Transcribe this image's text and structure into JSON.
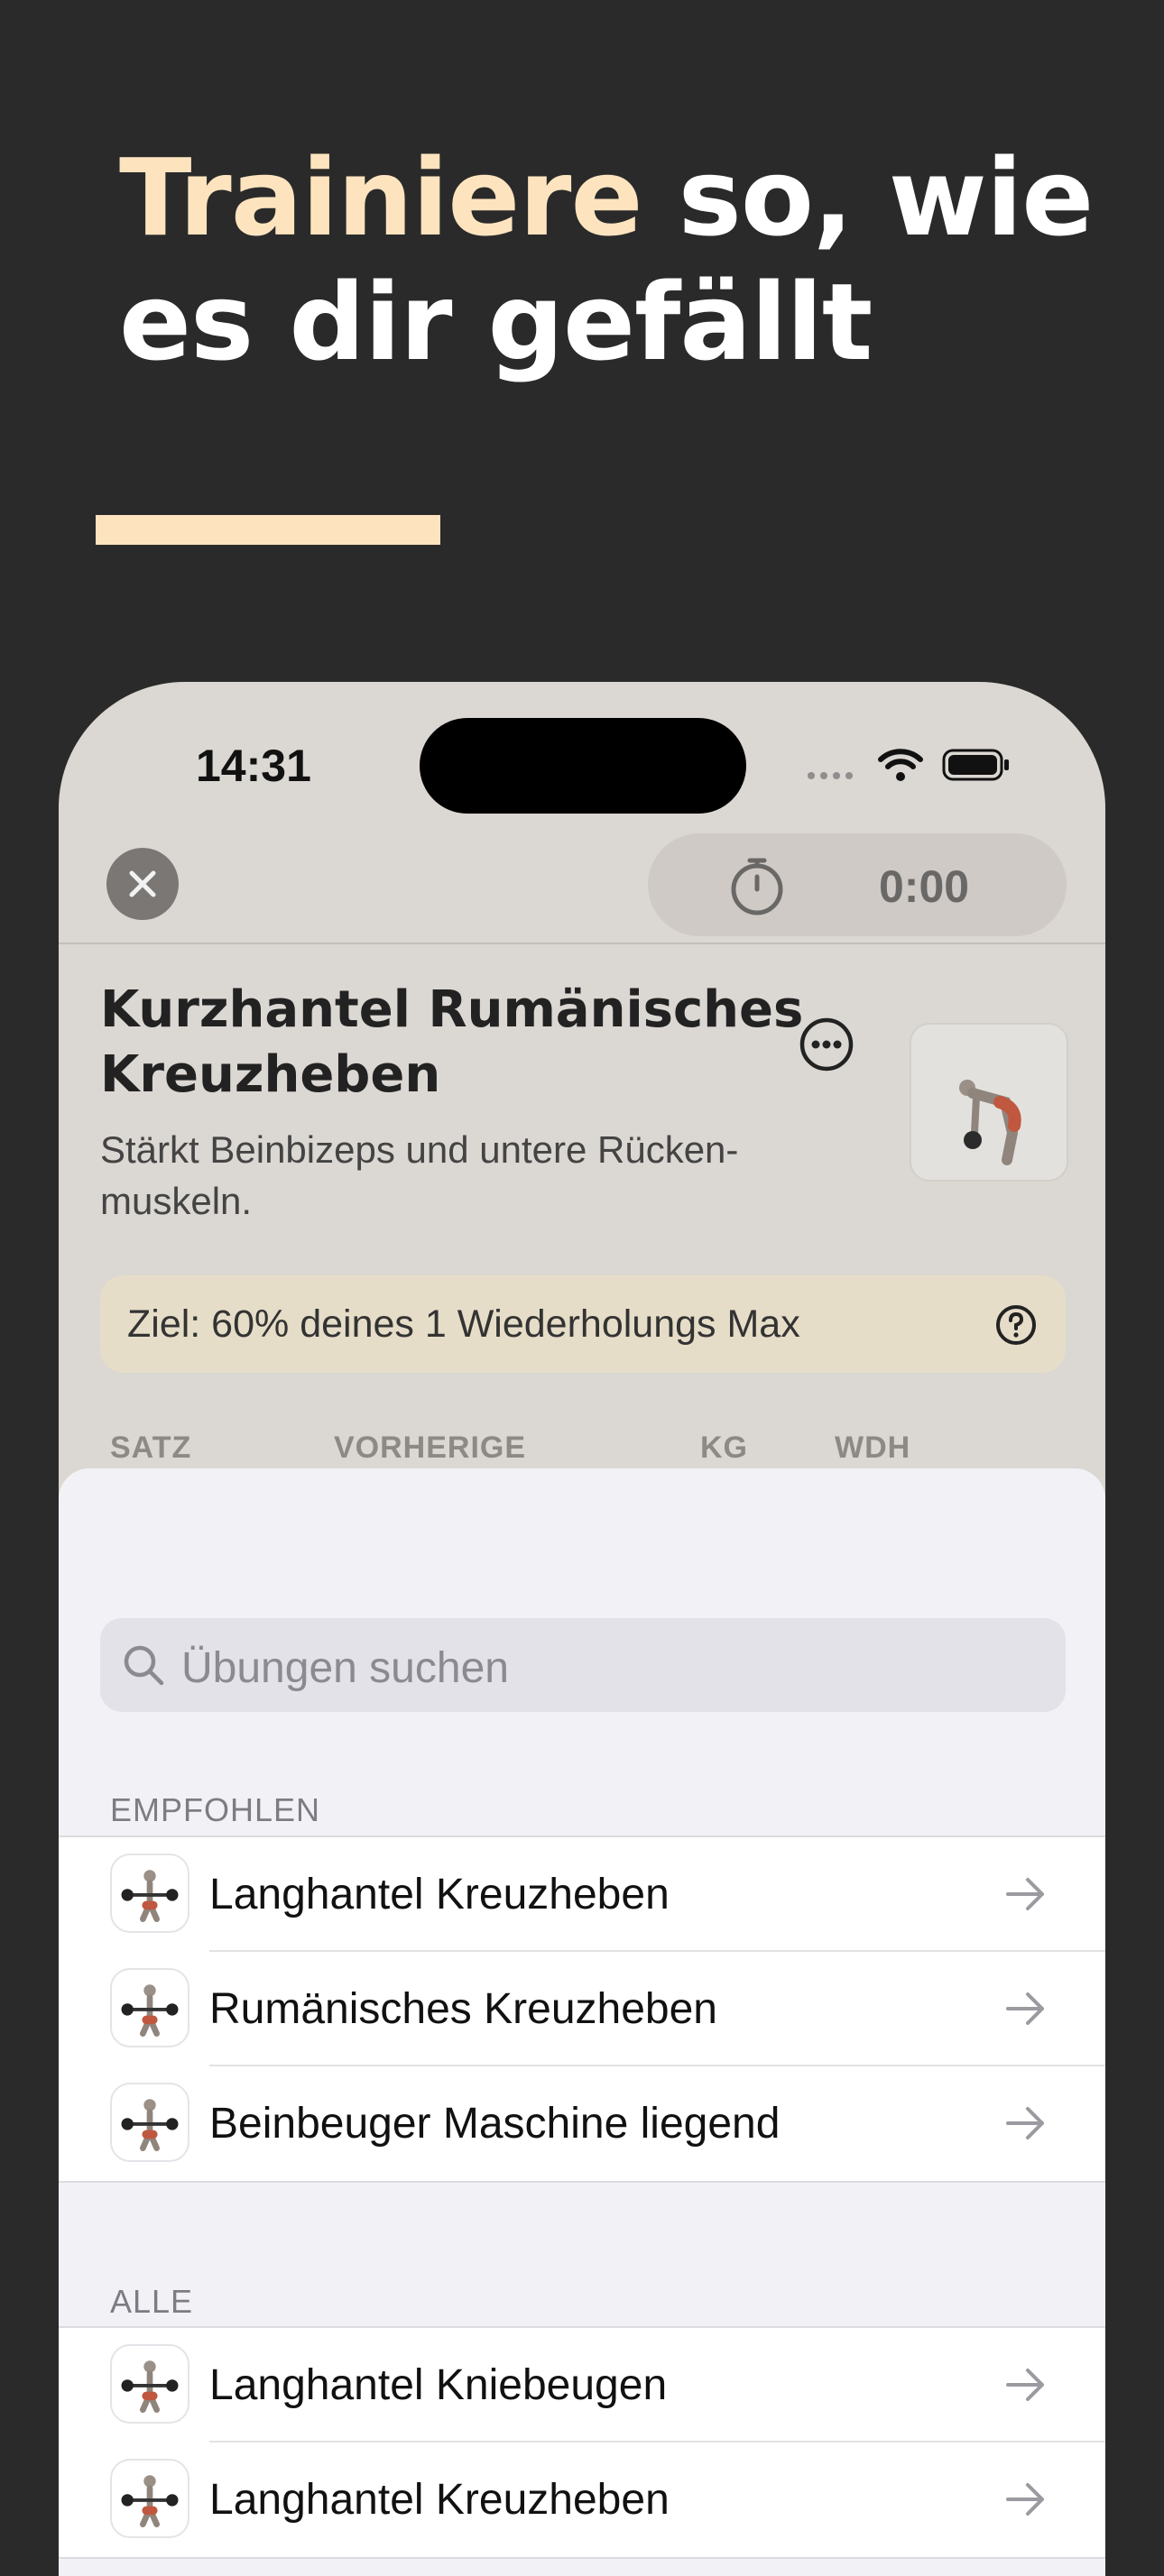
{
  "headline": {
    "accent": "Trainiere",
    "rest_line1": " so, wie",
    "line2": "es dir gefällt"
  },
  "colors": {
    "accent": "#fde4bf",
    "background": "#2a2a2a"
  },
  "status_bar": {
    "time": "14:31"
  },
  "nav": {
    "timer": "0:00"
  },
  "exercise": {
    "title": "Kurzhantel Rumänisches Kreuzheben",
    "description": "Stärkt Beinbizeps und untere Rücken-muskeln.",
    "goal": "Ziel: 60% deines 1 Wiederholungs Max"
  },
  "table_headers": {
    "set": "SATZ",
    "previous": "VORHERIGE",
    "kg": "KG",
    "reps": "WDH"
  },
  "search": {
    "placeholder": "Übungen suchen"
  },
  "recommended": {
    "label": "EMPFOHLEN",
    "items": [
      {
        "label": "Langhantel Kreuzheben"
      },
      {
        "label": "Rumänisches Kreuzheben"
      },
      {
        "label": "Beinbeuger Maschine liegend"
      }
    ]
  },
  "all": {
    "label": "ALLE",
    "items": [
      {
        "label": "Langhantel Kniebeugen"
      },
      {
        "label": "Langhantel Kreuzheben"
      }
    ]
  }
}
